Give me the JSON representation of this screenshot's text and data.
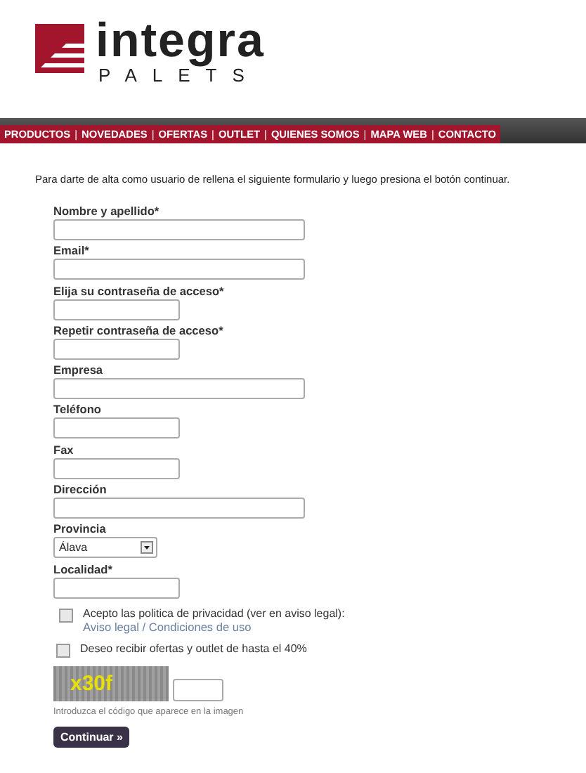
{
  "logo": {
    "name": "integra",
    "tagline": "PALETS"
  },
  "nav": [
    {
      "label": "PRODUCTOS",
      "separator": "|"
    },
    {
      "label": "NOVEDADES",
      "separator": "|"
    },
    {
      "label": "OFERTAS",
      "separator": "|"
    },
    {
      "label": "OUTLET",
      "separator": "|"
    },
    {
      "label": "QUIENES SOMOS",
      "separator": "|"
    },
    {
      "label": "MAPA WEB",
      "separator": "|"
    },
    {
      "label": "CONTACTO"
    }
  ],
  "intro": "Para darte de alta como usuario de rellena el siguiente formulario y luego presiona el botón continuar.",
  "fields": [
    {
      "label": "Nombre y apellido*",
      "kind": "wide"
    },
    {
      "label": "Email*",
      "kind": "wide"
    },
    {
      "label": "Elija su contraseña de acceso*",
      "kind": "narrow"
    },
    {
      "label": "Repetir contraseña de acceso*",
      "kind": "narrow"
    },
    {
      "label": "Empresa",
      "kind": "wide"
    },
    {
      "label": "Teléfono",
      "kind": "narrow"
    },
    {
      "label": "Fax",
      "kind": "narrow"
    },
    {
      "label": "Dirección",
      "kind": "wide"
    },
    {
      "label": "Provincia",
      "kind": "select",
      "value": "Álava"
    },
    {
      "label": "Localidad*",
      "kind": "narrow"
    }
  ],
  "privacy": {
    "text": "Acepto las politica de privacidad (ver en aviso legal):",
    "checked": false,
    "links": [
      "Aviso legal",
      "Condiciones de uso"
    ],
    "separator": "/"
  },
  "offers": {
    "text": "Deseo recibir ofertas y outlet de hasta el 40%",
    "checked": false
  },
  "captcha": {
    "code": "x30f",
    "hint": "Introduzca el código que aparece en la imagen"
  },
  "submit": "Continuar »"
}
